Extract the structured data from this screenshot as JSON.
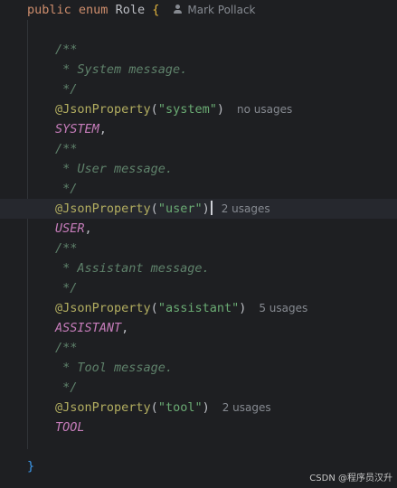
{
  "editor": {
    "header": {
      "kw_public": "public",
      "kw_enum": "enum",
      "class_name": "Role",
      "open_brace": "{",
      "author": "Mark Pollack"
    },
    "blocks": [
      {
        "comment_open": "/**",
        "comment_text": " * System message.",
        "comment_close": " */",
        "annotation": "@JsonProperty",
        "arg": "\"system\"",
        "usages": "no usages",
        "constant": "SYSTEM",
        "sep": ","
      },
      {
        "comment_open": "/**",
        "comment_text": " * User message.",
        "comment_close": " */",
        "annotation": "@JsonProperty",
        "arg": "\"user\"",
        "usages": "2 usages",
        "constant": "USER",
        "sep": ","
      },
      {
        "comment_open": "/**",
        "comment_text": " * Assistant message.",
        "comment_close": " */",
        "annotation": "@JsonProperty",
        "arg": "\"assistant\"",
        "usages": "5 usages",
        "constant": "ASSISTANT",
        "sep": ","
      },
      {
        "comment_open": "/**",
        "comment_text": " * Tool message.",
        "comment_close": " */",
        "annotation": "@JsonProperty",
        "arg": "\"tool\"",
        "usages": "2 usages",
        "constant": "TOOL",
        "sep": ""
      }
    ],
    "close_brace": "}"
  },
  "watermark": "CSDN @程序员汉升",
  "colors": {
    "background": "#1e1f22",
    "keyword": "#cf8e6d",
    "comment": "#5f826b",
    "annotation": "#b3ae60",
    "string": "#6aab73",
    "enum_constant": "#c77dbb",
    "hint": "#868a91"
  },
  "icons": {
    "author": "person-icon"
  }
}
